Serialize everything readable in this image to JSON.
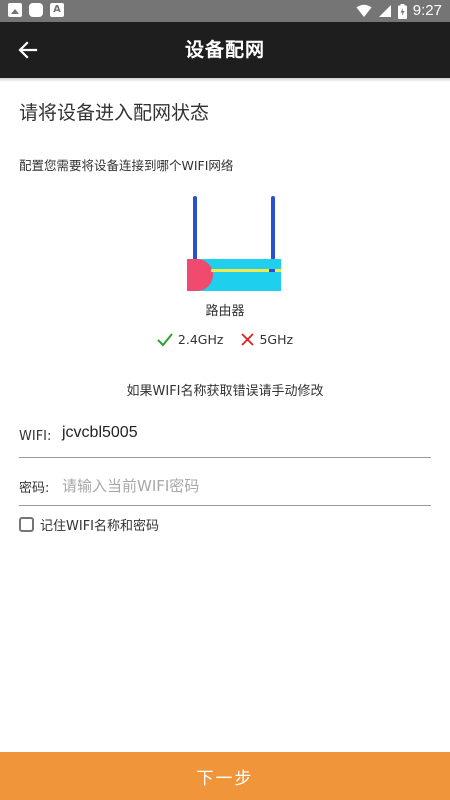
{
  "status_bar": {
    "time": "9:27"
  },
  "app_bar": {
    "title": "设备配网",
    "back_icon": "arrow-left-icon"
  },
  "page": {
    "heading": "请将设备进入配网状态",
    "instruction": "配置您需要将设备连接到哪个WIFI网络",
    "router_label": "路由器",
    "bands": {
      "supported": {
        "label": "2.4GHz",
        "icon": "check-icon",
        "color": "#2ea02e"
      },
      "unsupported": {
        "label": "5GHz",
        "icon": "cross-icon",
        "color": "#e02020"
      }
    },
    "hint": "如果WIFI名称获取错误请手动修改",
    "wifi_field": {
      "label": "WIFI:",
      "value": "jcvcbl5005"
    },
    "password_field": {
      "label": "密码:",
      "placeholder": "请输入当前WIFI密码"
    },
    "remember": {
      "label": "记住WIFI名称和密码",
      "checked": false
    }
  },
  "next_button": {
    "label": "下一步",
    "color": "#f0953a"
  },
  "colors": {
    "appbar": "#1e1e1e",
    "router_body": "#1ecfee",
    "router_accent": "#f04a6e",
    "antenna": "#2a4fd0"
  }
}
